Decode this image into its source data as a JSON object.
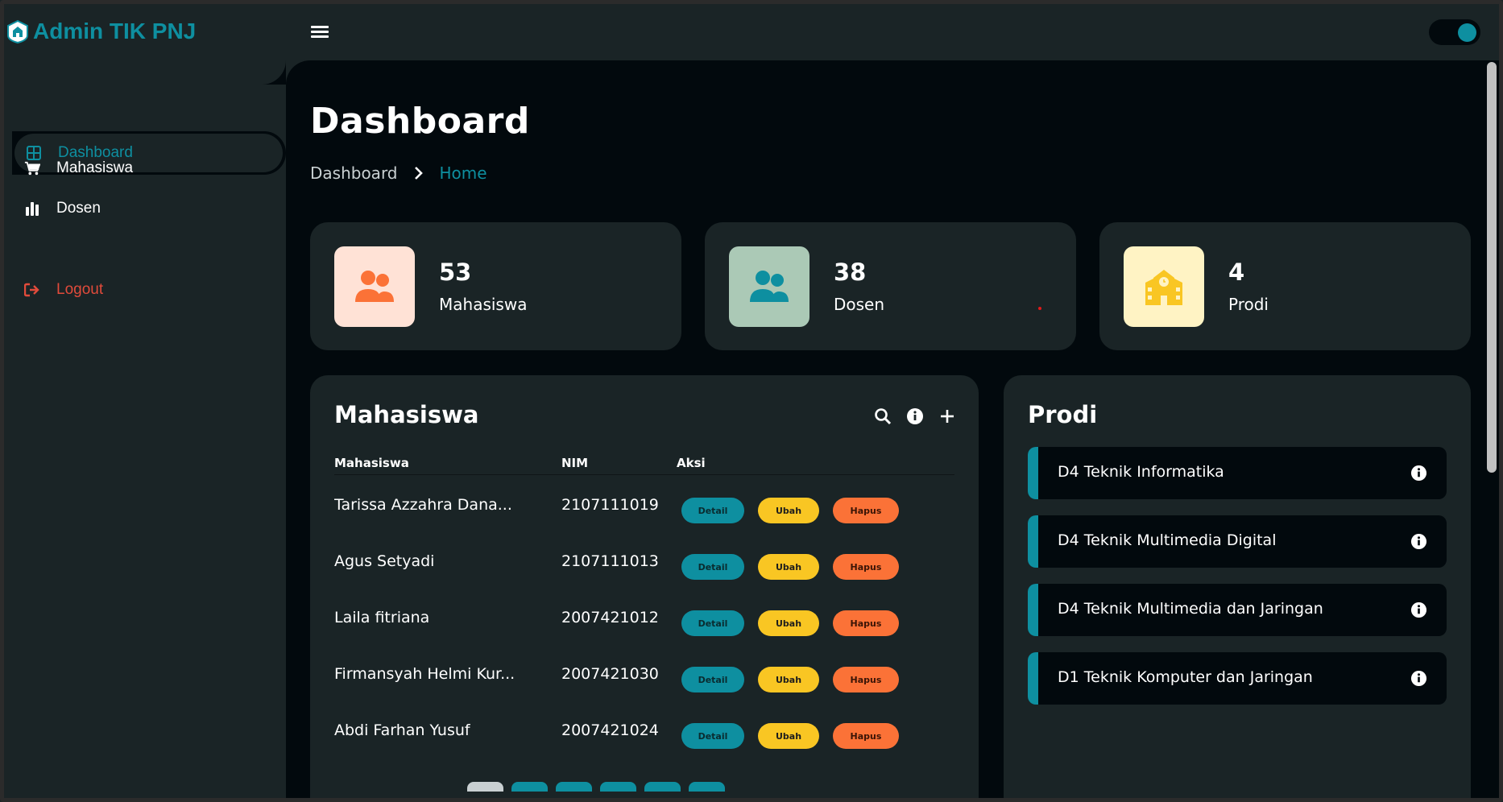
{
  "brand": {
    "name": "Admin TIK PNJ"
  },
  "sidebar": {
    "items": [
      {
        "label": "Dashboard",
        "icon": "dashboard-grid-icon",
        "active": true
      },
      {
        "label": "Mahasiswa",
        "icon": "cart-icon"
      },
      {
        "label": "Dosen",
        "icon": "bar-chart-icon"
      }
    ],
    "logout": {
      "label": "Logout",
      "icon": "logout-icon"
    }
  },
  "page": {
    "title": "Dashboard",
    "breadcrumb": [
      "Dashboard",
      "Home"
    ]
  },
  "stats": [
    {
      "value": "53",
      "label": "Mahasiswa",
      "icon": "users-icon",
      "icon_bg": "#ffe2d6",
      "icon_color": "#fb7237"
    },
    {
      "value": "38",
      "label": "Dosen",
      "icon": "users-icon",
      "icon_bg": "#abc9b6",
      "icon_color": "#0e8fa0"
    },
    {
      "value": "4",
      "label": "Prodi",
      "icon": "school-icon",
      "icon_bg": "#fff3c4",
      "icon_color": "#f9c623"
    }
  ],
  "mahasiswa_panel": {
    "title": "Mahasiswa",
    "columns": [
      "Mahasiswa",
      "NIM",
      "Aksi"
    ],
    "rows": [
      {
        "name": "Tarissa Azzahra Dana...",
        "nim": "2107111019"
      },
      {
        "name": "Agus Setyadi",
        "nim": "2107111013"
      },
      {
        "name": "Laila fitriana",
        "nim": "2007421012"
      },
      {
        "name": "Firmansyah Helmi Kur...",
        "nim": "2007421030"
      },
      {
        "name": "Abdi Farhan Yusuf",
        "nim": "2007421024"
      }
    ],
    "actions": {
      "detail": "Detail",
      "ubah": "Ubah",
      "hapus": "Hapus"
    }
  },
  "prodi_panel": {
    "title": "Prodi",
    "items": [
      "D4 Teknik Informatika",
      "D4 Teknik Multimedia Digital",
      "D4 Teknik Multimedia dan Jaringan",
      "D1 Teknik Komputer dan Jaringan"
    ]
  },
  "colors": {
    "accent": "#0e8fa0",
    "background": "#02090d",
    "surface": "#1a2426",
    "warning": "#f9c623",
    "danger": "#fb7237",
    "logout": "#e14b3b"
  }
}
